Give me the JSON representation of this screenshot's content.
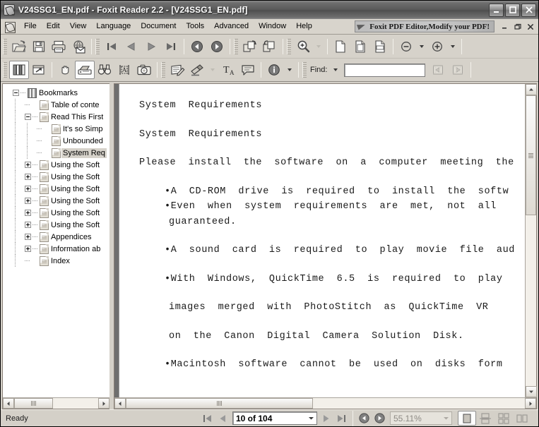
{
  "window": {
    "title": "V24SSG1_EN.pdf - Foxit Reader 2.2 - [V24SSG1_EN.pdf]",
    "icon": "foxit-app-icon",
    "minimize": "_",
    "maximize": "□",
    "close": "×"
  },
  "menubar": {
    "doc_icon": "document-icon",
    "items": [
      {
        "label": "File"
      },
      {
        "label": "Edit"
      },
      {
        "label": "View"
      },
      {
        "label": "Language"
      },
      {
        "label": "Document"
      },
      {
        "label": "Tools"
      },
      {
        "label": "Advanced"
      },
      {
        "label": "Window"
      },
      {
        "label": "Help"
      }
    ],
    "ad_banner": {
      "text": "Foxit PDF Editor,Modify your PDF!",
      "icon": "paper-plane-icon"
    },
    "mdi_buttons": [
      {
        "name": "mdi-minimize",
        "glyph": "_"
      },
      {
        "name": "mdi-restore",
        "glyph": "❐"
      },
      {
        "name": "mdi-close",
        "glyph": "✕"
      }
    ]
  },
  "toolbar_row1": [
    {
      "name": "open-button",
      "icon": "open-folder-icon"
    },
    {
      "name": "save-button",
      "icon": "floppy-disk-icon"
    },
    {
      "name": "print-button",
      "icon": "printer-icon"
    },
    {
      "name": "email-button",
      "icon": "email-globe-icon"
    },
    {
      "name": "first-page-button",
      "icon": "first-page-icon"
    },
    {
      "name": "previous-page-button",
      "icon": "previous-page-icon"
    },
    {
      "name": "next-page-button",
      "icon": "next-page-icon"
    },
    {
      "name": "last-page-button",
      "icon": "last-page-icon"
    },
    {
      "name": "go-back-button",
      "icon": "back-arrow-icon"
    },
    {
      "name": "go-forward-button",
      "icon": "forward-arrow-icon"
    },
    {
      "name": "rotate-clockwise-button",
      "icon": "rotate-cw-icon"
    },
    {
      "name": "rotate-counterclockwise-button",
      "icon": "rotate-ccw-icon"
    },
    {
      "name": "zoom-tool-button",
      "icon": "magnifier-plus-icon"
    },
    {
      "name": "actual-size-button",
      "icon": "page-actual-size-icon"
    },
    {
      "name": "fit-page-button",
      "icon": "page-fit-icon"
    },
    {
      "name": "fit-width-button",
      "icon": "page-fit-width-icon"
    },
    {
      "name": "zoom-out-button",
      "icon": "minus-circle-icon"
    },
    {
      "name": "zoom-in-button",
      "icon": "plus-circle-icon"
    }
  ],
  "toolbar_row2": [
    {
      "name": "bookmarks-panel-button",
      "icon": "bookmarks-icon",
      "pressed": true
    },
    {
      "name": "page-thumbnail-button",
      "icon": "page-arrow-icon"
    },
    {
      "name": "hand-tool-button",
      "icon": "hand-icon"
    },
    {
      "name": "select-tool-button",
      "icon": "select-tool-icon",
      "pressed": true
    },
    {
      "name": "find-tool-button",
      "icon": "binoculars-icon"
    },
    {
      "name": "text-select-button",
      "icon": "text-select-icon"
    },
    {
      "name": "snapshot-button",
      "icon": "camera-icon"
    },
    {
      "name": "annotate-button",
      "icon": "pencil-note-icon"
    },
    {
      "name": "highlight-button",
      "icon": "highlighter-icon"
    },
    {
      "name": "typewriter-button",
      "icon": "typewriter-icon"
    },
    {
      "name": "note-button",
      "icon": "sticky-note-icon"
    },
    {
      "name": "document-info-button",
      "icon": "info-circle-icon"
    }
  ],
  "find": {
    "label": "Find:",
    "value": "",
    "placeholder": "",
    "find-previous": "find-previous-icon",
    "find-next": "find-next-icon"
  },
  "sidebar": {
    "panel": "bookmarks",
    "tree": [
      {
        "label": "Bookmarks",
        "depth": 0,
        "toggle": "minus",
        "icon": "bookmarks-icon",
        "selected": false
      },
      {
        "label": "Table of conte",
        "depth": 1,
        "toggle": "none",
        "icon": "page-icon",
        "selected": false
      },
      {
        "label": "Read This First",
        "depth": 1,
        "toggle": "minus",
        "icon": "page-icon",
        "selected": false
      },
      {
        "label": "It's so Simp",
        "depth": 2,
        "toggle": "none",
        "icon": "page-icon",
        "selected": false
      },
      {
        "label": "Unbounded",
        "depth": 2,
        "toggle": "none",
        "icon": "page-icon",
        "selected": false
      },
      {
        "label": "System Req",
        "depth": 2,
        "toggle": "none",
        "icon": "page-icon",
        "selected": true
      },
      {
        "label": "Using the Soft",
        "depth": 1,
        "toggle": "plus",
        "icon": "page-icon",
        "selected": false
      },
      {
        "label": "Using the Soft",
        "depth": 1,
        "toggle": "plus",
        "icon": "page-icon",
        "selected": false
      },
      {
        "label": "Using the Soft",
        "depth": 1,
        "toggle": "plus",
        "icon": "page-icon",
        "selected": false
      },
      {
        "label": "Using the Soft",
        "depth": 1,
        "toggle": "plus",
        "icon": "page-icon",
        "selected": false
      },
      {
        "label": "Using the Soft",
        "depth": 1,
        "toggle": "plus",
        "icon": "page-icon",
        "selected": false
      },
      {
        "label": "Using the Soft",
        "depth": 1,
        "toggle": "plus",
        "icon": "page-icon",
        "selected": false
      },
      {
        "label": "Appendices",
        "depth": 1,
        "toggle": "plus",
        "icon": "page-icon",
        "selected": false
      },
      {
        "label": "Information ab",
        "depth": 1,
        "toggle": "plus",
        "icon": "page-icon",
        "selected": false
      },
      {
        "label": "Index",
        "depth": 1,
        "toggle": "none",
        "icon": "page-icon",
        "selected": false
      }
    ]
  },
  "document": {
    "lines": [
      {
        "text": "System  Requirements",
        "style": "normal"
      },
      {
        "text": "System  Requirements",
        "style": "normal"
      },
      {
        "text": "Please  install  the  software  on  a  computer  meeting  the  f",
        "style": "normal"
      },
      {
        "text": "•A  CD-ROM  drive  is  required  to  install  the  softw",
        "style": "bullet-tight"
      },
      {
        "text": "•Even  when  system  requirements  are  met,  not  all",
        "style": "bullet-tight"
      },
      {
        "text": "guaranteed.",
        "style": "indent"
      },
      {
        "text": "•A  sound  card  is  required  to  play  movie  file  aud",
        "style": "bullet"
      },
      {
        "text": "•With  Windows,  QuickTime  6.5  is  required  to  play",
        "style": "bullet"
      },
      {
        "text": "images  merged  with  PhotoStitch  as  QuickTime  VR",
        "style": "indent"
      },
      {
        "text": "on  the  Canon  Digital  Camera  Solution  Disk.",
        "style": "indent"
      },
      {
        "text": "•Macintosh  software  cannot  be  used  on  disks  form",
        "style": "bullet-extra"
      }
    ]
  },
  "statusbar": {
    "status": "Ready",
    "first_page_button": "first-page-icon",
    "previous_page_button": "previous-page-icon",
    "page_value": "10 of 104",
    "next_page_button": "next-page-icon",
    "last_page_button": "last-page-icon",
    "back_button": "back-arrow-icon",
    "forward_button": "forward-arrow-icon",
    "zoom_value": "55.11%",
    "layout_buttons": [
      {
        "name": "single-page-layout-button",
        "icon": "single-page-icon",
        "pressed": true
      },
      {
        "name": "continuous-layout-button",
        "icon": "continuous-pages-icon",
        "pressed": false
      },
      {
        "name": "facing-layout-button",
        "icon": "facing-pages-icon",
        "pressed": false
      },
      {
        "name": "continuous-facing-layout-button",
        "icon": "continuous-facing-icon",
        "pressed": false
      }
    ]
  },
  "colors": {
    "titlebar": "#5a5a5a",
    "chrome": "#d4d0c8",
    "page": "#ffffff",
    "page_backdrop": "#6e6e6e",
    "selection": "#d6d2ca"
  }
}
